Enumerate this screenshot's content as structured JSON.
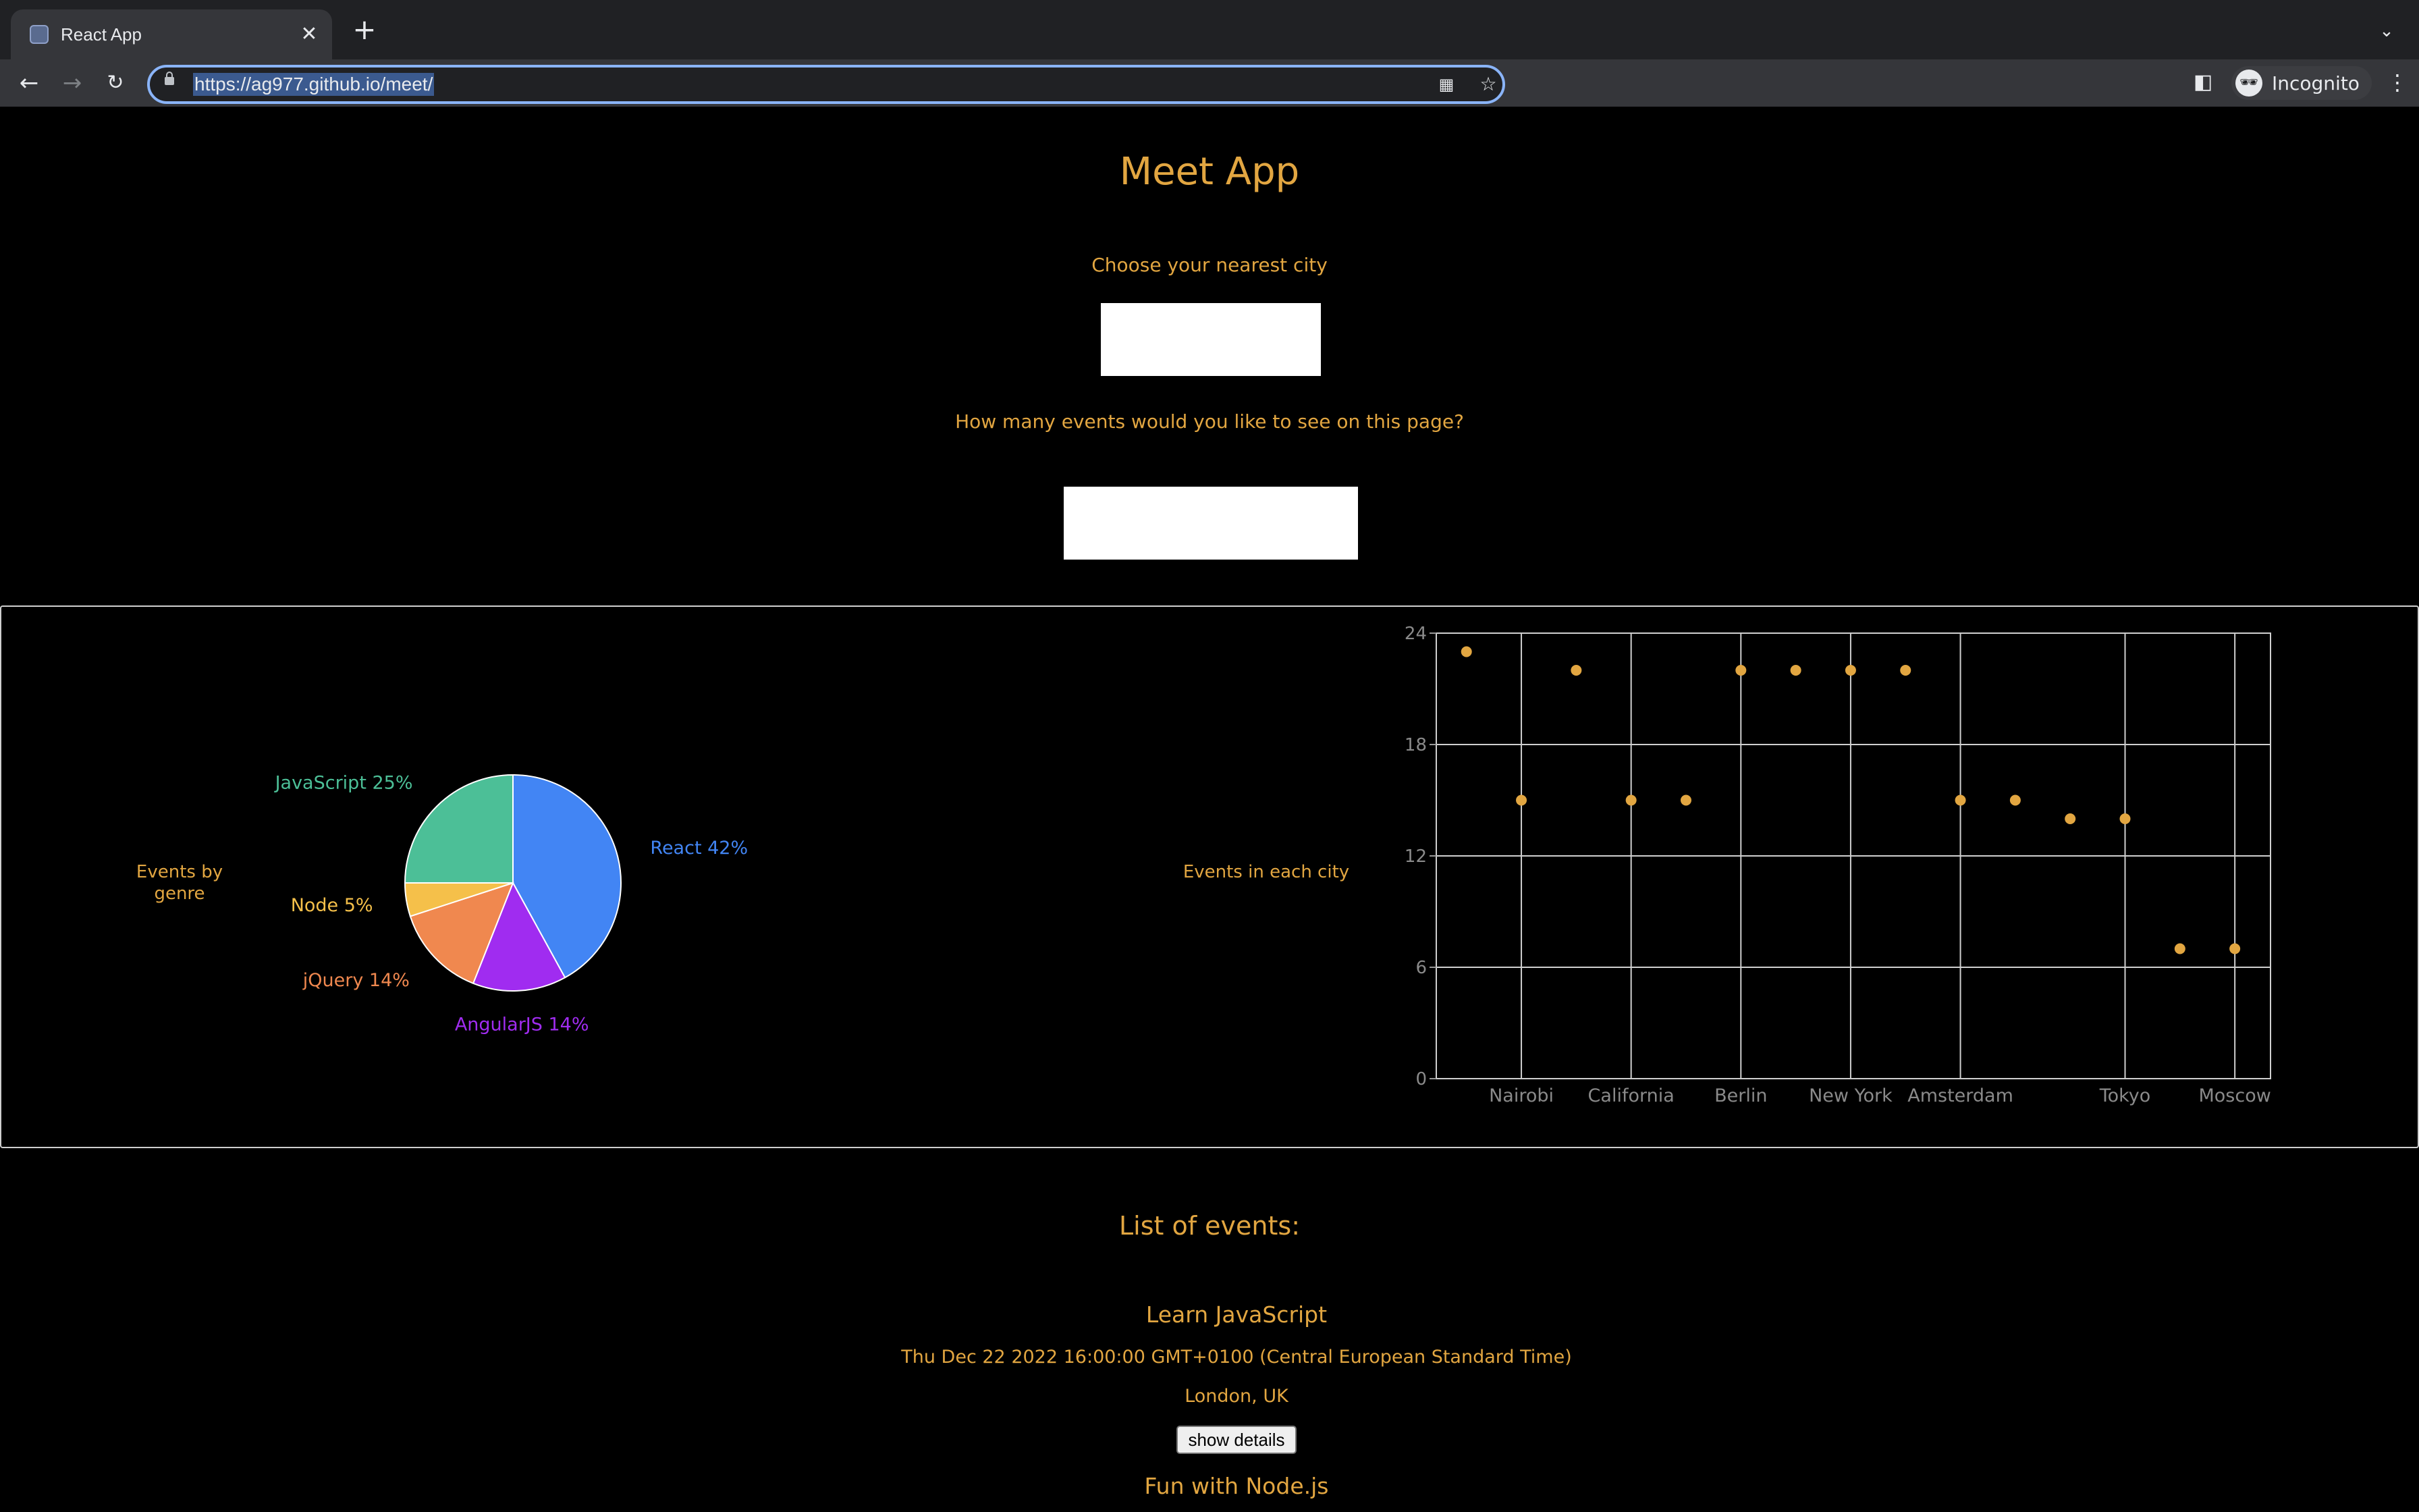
{
  "browser": {
    "tab_title": "React App",
    "close_glyph": "✕",
    "new_tab_glyph": "+",
    "url": "https://ag977.github.io/meet/",
    "profile_label": "Incognito",
    "icons": [
      "back-arrow-icon",
      "forward-arrow-icon",
      "reload-icon",
      "lock-icon",
      "qr-code-icon",
      "star-icon",
      "side-panel-icon",
      "incognito-icon",
      "menu-icon",
      "tab-search-icon"
    ]
  },
  "app": {
    "title": "Meet App",
    "city_label": "Choose your nearest city",
    "city_value": "",
    "number_label": "How many events would you like to see on this page?",
    "number_value": ""
  },
  "charts": {
    "pie_title": "Events by genre",
    "scatter_title": "Events in each city"
  },
  "chart_data": [
    {
      "type": "pie",
      "title": "Events by genre",
      "slices": [
        {
          "label": "React 42%",
          "value": 42,
          "color": "#4285f4"
        },
        {
          "label": "AngularJS 14%",
          "value": 14,
          "color": "#a02cf0"
        },
        {
          "label": "jQuery 14%",
          "value": 14,
          "color": "#f0884f"
        },
        {
          "label": "Node 5%",
          "value": 5,
          "color": "#f5c04a"
        },
        {
          "label": "JavaScript 25%",
          "value": 25,
          "color": "#4cbf97"
        }
      ]
    },
    {
      "type": "scatter",
      "title": "Events in each city",
      "x_tick_labels": [
        "Nairobi",
        "California",
        "Berlin",
        "New York",
        "Amsterdam",
        "Tokyo",
        "Moscow"
      ],
      "y_ticks": [
        0,
        6,
        12,
        18,
        24
      ],
      "ylim": [
        0,
        24
      ],
      "point_color": "#e2a641",
      "grid": true,
      "points": [
        23,
        15,
        22,
        15,
        15,
        22,
        22,
        22,
        22,
        15,
        15,
        14,
        14,
        7,
        7
      ]
    }
  ],
  "events": {
    "list_title": "List of events:",
    "items": [
      {
        "name": "Learn JavaScript",
        "date": "Thu Dec 22 2022 16:00:00 GMT+0100 (Central European Standard Time)",
        "location": "London, UK",
        "button": "show details"
      },
      {
        "name": "Fun with Node.js"
      }
    ]
  }
}
